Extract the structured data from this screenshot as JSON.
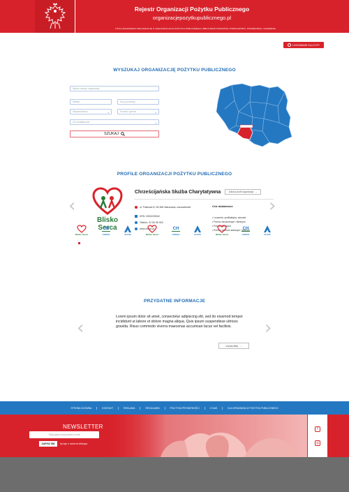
{
  "header": {
    "title": "Rejestr Organizacji Pożytku Publicznego",
    "url": "organizacjepozytkupublicznego.pl",
    "subtitle": "TUTAJ ZNAJDZIESZ ORGANIZACJE O ORGANIZACJACH POŻYTKU PUBLICZNEGO, BIBLIOTEKĘ FINANSÓW, PODSKAZÓWKI, PODRĘCZNIKI, NARZĘDZIA"
  },
  "login": {
    "label": "LOGOWANIE DLA O.P.P."
  },
  "search": {
    "title": "WYSZUKAJ ORGANIZACJĘ POŻYTKU PUBLICZNEGO",
    "name_placeholder": "Wpisz nazwę organizacji",
    "city_placeholder": "Miasto",
    "krs_placeholder": "Kod pocztowy",
    "voivodeship_placeholder": "Województwo",
    "district_placeholder": "Powiat / gmina",
    "goal_placeholder": "Cel działalności",
    "button_label": "SZUKAJ"
  },
  "profiles": {
    "title": "PROFILE ORGANIZACJI POŻYTKU PUBLICZNEGO",
    "org_name": "Chrześcijańska Służba Charytatywna",
    "profile_button": "Zobacz profil organizacji",
    "logo_text_1": "Blisko",
    "logo_text_2": "Serca",
    "address": "ul. Fiołkowa 8, 05-366 Warszawa, mazowieckie",
    "krs": "KRS: 0000225018",
    "phone": "Telefon: 22 54 95 920",
    "www": "www.chsch.pl",
    "goals_title": "Cele działalności:",
    "goals": [
      "• Leczenie, profilaktyka, zdrowie",
      "• Pomoc bezdomnym i biednym",
      "• Pomoc dzieciom",
      "• Pomoc osobom starszym i chorym"
    ],
    "strip_labels": [
      "Blisko Serca",
      "CHSCH",
      "ALIVIA"
    ]
  },
  "useful": {
    "title": "PRZYDATNE INFORMACJE",
    "body": "Lorem ipsum dolor sit amet, consectetur adipiscing elit, sed do eiusmod tempor incididunt ut labore et dolore magna aliqua. Quis ipsum suspendisse ultrices gravida. Risus commodo viverra maecenas accumsan lacus vel facilisis.",
    "more_label": "czytaj dalej"
  },
  "footer_nav": [
    "STRONA GŁÓWNA",
    "KONTAKT",
    "REKLAMA",
    "REGULAMIN",
    "POLITYKA PRYWATNOŚCI",
    "O NAS",
    "DLA ORGANIZACJI POŻYTKU PUBLICZNEGO"
  ],
  "newsletter": {
    "title": "NEWSLETTER",
    "placeholder": "Tutaj wpisz swój adres e-mail",
    "button": "ZAPISZ SIĘ",
    "note": "by być z nami na bieżąco"
  },
  "colors": {
    "brand_red": "#d8222b",
    "brand_blue": "#2478c2",
    "title_blue": "#1f6bb5"
  }
}
